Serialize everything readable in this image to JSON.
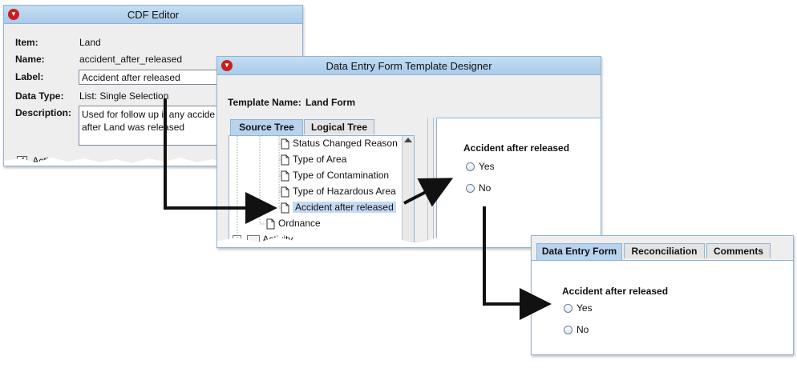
{
  "cdf_editor": {
    "title": "CDF Editor",
    "item_label": "Item:",
    "item_value": "Land",
    "name_label": "Name:",
    "name_value": "accident_after_released",
    "label_label": "Label:",
    "label_value": "Accident after released",
    "datatype_label": "Data Type:",
    "datatype_value": "List: Single Selection",
    "description_label": "Description:",
    "description_line1": "Used for follow up if any accide",
    "description_line2": "after Land was released",
    "active_label": "Active"
  },
  "designer": {
    "title": "Data Entry Form Template Designer",
    "template_name_label": "Template Name:",
    "template_name_value": "Land Form",
    "tabs": [
      "Source Tree",
      "Logical Tree"
    ],
    "tree_items": [
      "Status Changed Reason",
      "Type of Area",
      "Type of Contamination",
      "Type of Hazardous Area",
      "Accident after released",
      "Ordnance",
      "Activity"
    ],
    "preview_question": "Accident after released",
    "preview_options": [
      "Yes",
      "No"
    ]
  },
  "data_entry": {
    "tabs": [
      "Data Entry Form",
      "Reconciliation",
      "Comments"
    ],
    "question": "Accident after released",
    "options": [
      "Yes",
      "No"
    ]
  }
}
